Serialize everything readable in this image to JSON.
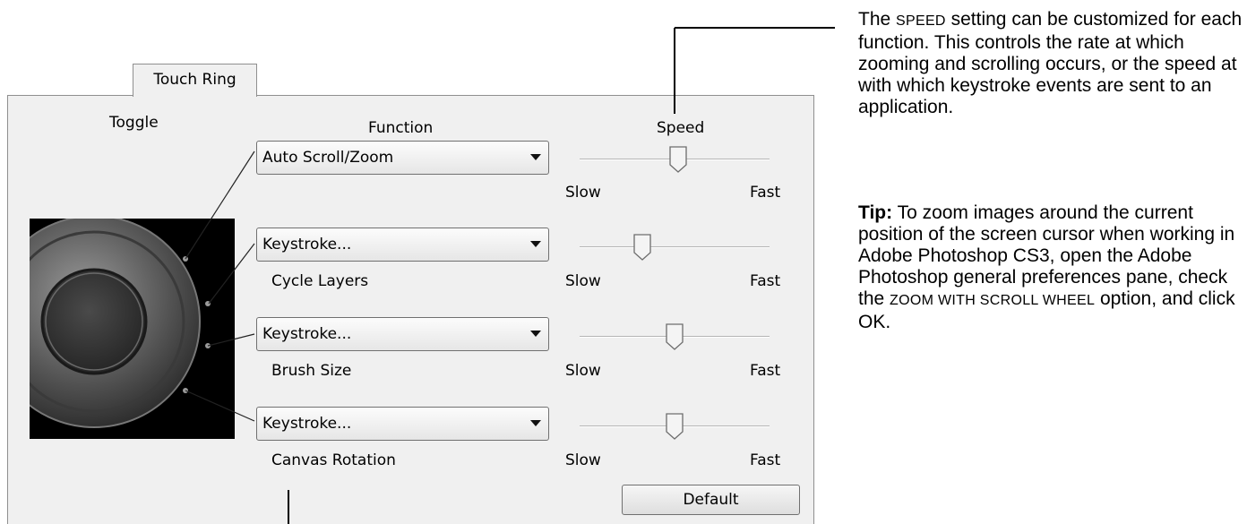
{
  "tab": {
    "label": "Touch Ring"
  },
  "headers": {
    "toggle": "Toggle",
    "function": "Function",
    "speed": "Speed"
  },
  "rows": [
    {
      "function": "Auto Scroll/Zoom",
      "sublabel": "",
      "slow": "Slow",
      "fast": "Fast",
      "speed": 0.52
    },
    {
      "function": "Keystroke...",
      "sublabel": "Cycle Layers",
      "slow": "Slow",
      "fast": "Fast",
      "speed": 0.33
    },
    {
      "function": "Keystroke...",
      "sublabel": "Brush Size",
      "slow": "Slow",
      "fast": "Fast",
      "speed": 0.5
    },
    {
      "function": "Keystroke...",
      "sublabel": "Canvas Rotation",
      "slow": "Slow",
      "fast": "Fast",
      "speed": 0.5
    }
  ],
  "default_button": "Default",
  "note": {
    "speed_p1": "The ",
    "speed_word": "Speed",
    "speed_p2": " setting can be customized for each function. This controls the rate at which zooming and scrolling occurs, or the speed at with which keystroke events are sent to an application.",
    "tip_label": "Tip:",
    "tip_p1": " To zoom images around the current position of the screen cursor when working in Adobe Photoshop CS3, open the Adobe Photoshop general preferences pane, check the ",
    "tip_option": "Zoom with Scroll Wheel",
    "tip_p2": " option, and click OK."
  }
}
